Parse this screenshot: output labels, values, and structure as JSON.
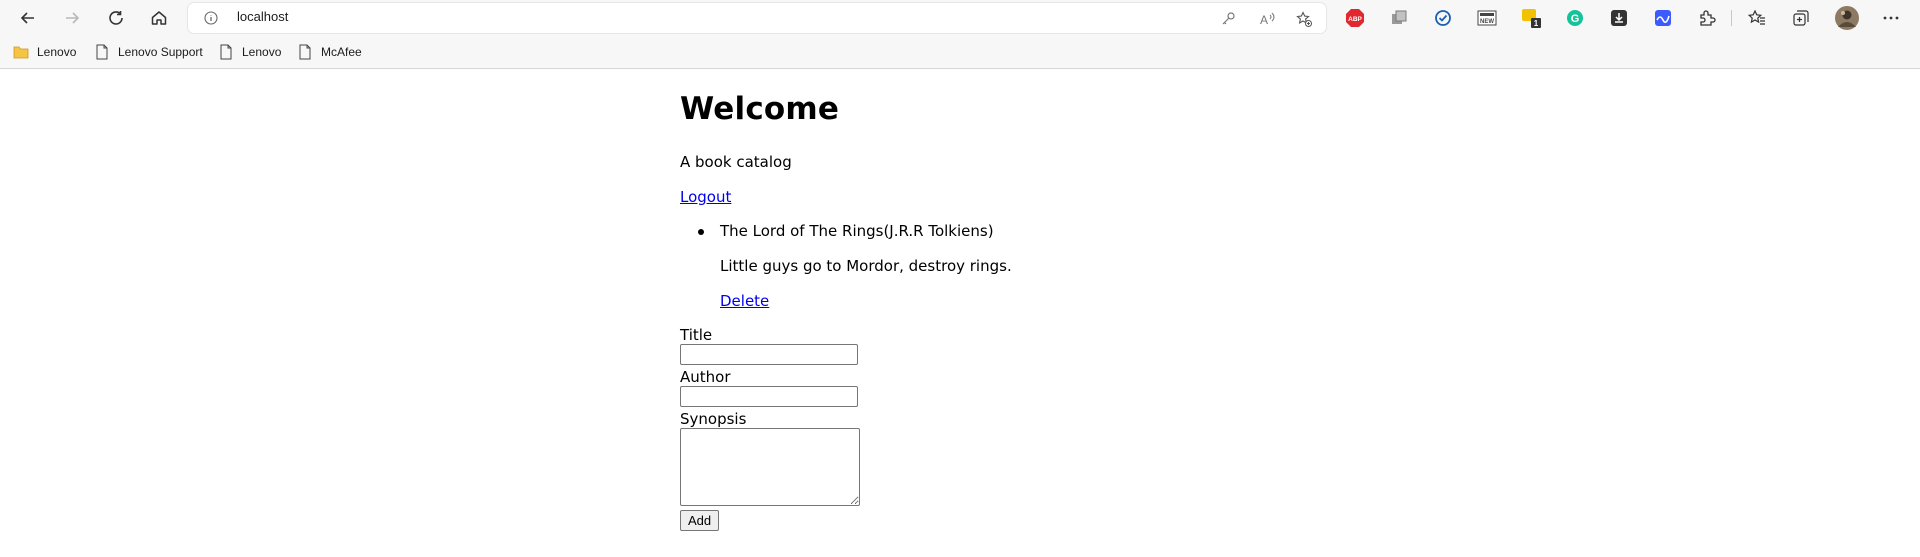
{
  "browser": {
    "url": "localhost",
    "toolbar_icons": {
      "back": "back-arrow-icon",
      "forward": "forward-arrow-icon",
      "refresh": "refresh-icon",
      "home": "home-icon",
      "site_info": "info-icon",
      "password": "key-icon",
      "read_aloud": "read-aloud-icon",
      "favorite": "star-add-icon"
    },
    "extensions": [
      {
        "name": "adblock-plus-icon",
        "label": "ABP",
        "color": "#e0282e"
      },
      {
        "name": "copy-extension-icon",
        "color": "#7a7a7a"
      },
      {
        "name": "check-circle-icon",
        "color": "#1a5fb4"
      },
      {
        "name": "news-icon",
        "label": "NEW",
        "color": "#444444"
      },
      {
        "name": "badge-extension-icon",
        "label": "1",
        "color": "#f2c200"
      },
      {
        "name": "grammarly-icon",
        "label": "G",
        "color": "#15c39a"
      },
      {
        "name": "download-extension-icon",
        "color": "#333333"
      },
      {
        "name": "wave-extension-icon",
        "color": "#3c5bff"
      },
      {
        "name": "puzzle-extensions-icon",
        "color": "#333333"
      },
      {
        "name": "favorites-icon",
        "color": "#333333"
      },
      {
        "name": "collections-icon",
        "color": "#333333"
      },
      {
        "name": "profile-avatar",
        "color": "#5a4a3a"
      },
      {
        "name": "more-menu-icon",
        "label": "...",
        "color": "#333333"
      }
    ],
    "bookmarks": [
      {
        "label": "Lenovo",
        "icon": "folder-icon"
      },
      {
        "label": "Lenovo Support",
        "icon": "page-icon"
      },
      {
        "label": "Lenovo",
        "icon": "page-icon"
      },
      {
        "label": "McAfee",
        "icon": "page-icon"
      }
    ]
  },
  "page": {
    "heading": "Welcome",
    "subtitle": "A book catalog",
    "logout_label": "Logout",
    "books": [
      {
        "title_line": "The Lord of The Rings(J.R.R Tolkiens)",
        "synopsis": "Little guys go to Mordor, destroy rings.",
        "delete_label": "Delete"
      }
    ],
    "form": {
      "title_label": "Title",
      "title_value": "",
      "author_label": "Author",
      "author_value": "",
      "synopsis_label": "Synopsis",
      "synopsis_value": "",
      "add_label": "Add"
    },
    "link_color": "#0000ee"
  }
}
